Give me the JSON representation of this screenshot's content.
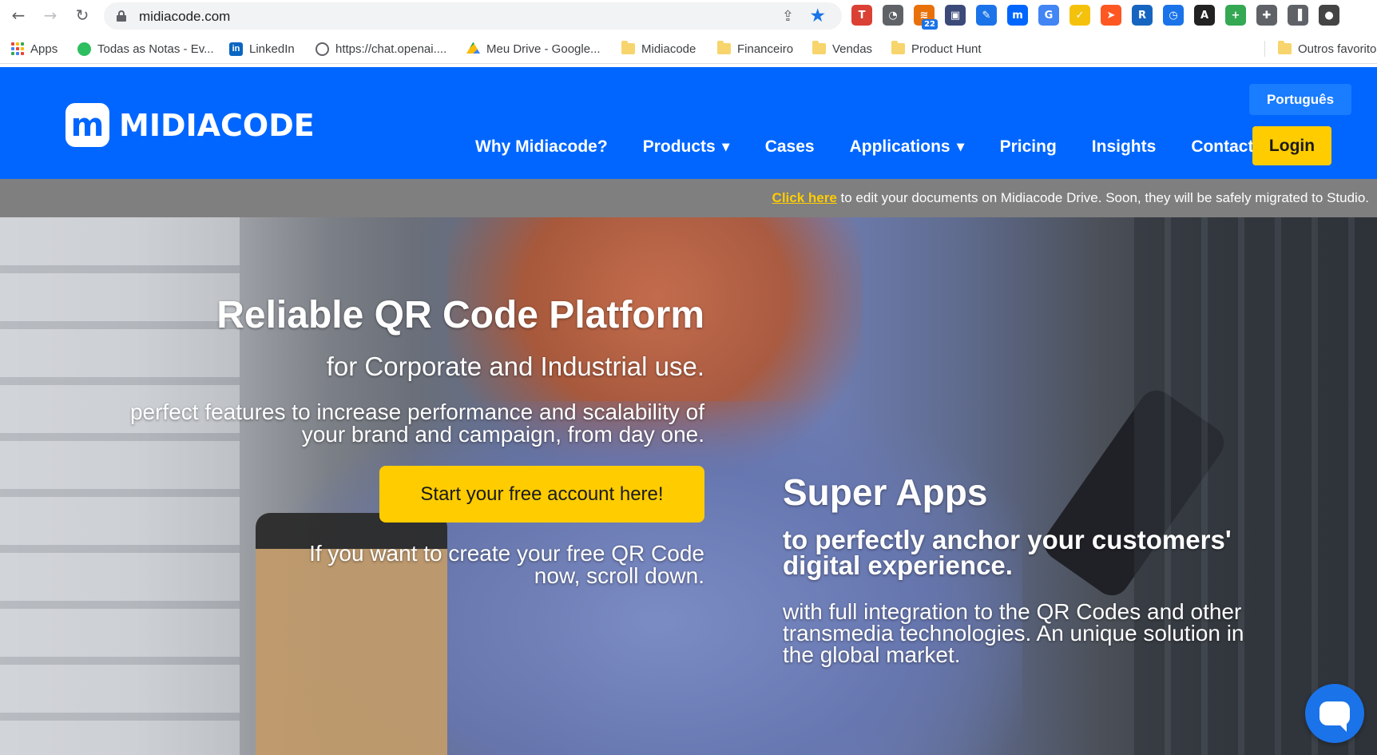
{
  "browser": {
    "url": "midiacode.com",
    "extensions": [
      {
        "name": "todoist-extension-icon",
        "glyph": "T",
        "color": "#db4035"
      },
      {
        "name": "speedometer-extension-icon",
        "glyph": "◔",
        "color": "#5f6368"
      },
      {
        "name": "feed-extension-icon",
        "glyph": "≋",
        "color": "#e8710a",
        "badge": "22"
      },
      {
        "name": "picture-extension-icon",
        "glyph": "▣",
        "color": "#3c4a7a"
      },
      {
        "name": "pen-extension-icon",
        "glyph": "✎",
        "color": "#1a73e8"
      },
      {
        "name": "midiacode-extension-icon",
        "glyph": "m",
        "color": "#0066ff"
      },
      {
        "name": "translate-extension-icon",
        "glyph": "G",
        "color": "#4285f4"
      },
      {
        "name": "checkmark-extension-icon",
        "glyph": "✓",
        "color": "#f4c20d"
      },
      {
        "name": "paper-plane-extension-icon",
        "glyph": "➤",
        "color": "#ff5722"
      },
      {
        "name": "r-extension-icon",
        "glyph": "R",
        "color": "#1565c0"
      },
      {
        "name": "clock-extension-icon",
        "glyph": "◷",
        "color": "#1a73e8"
      },
      {
        "name": "a-extension-icon",
        "glyph": "A",
        "color": "#222222"
      },
      {
        "name": "plus-extension-icon",
        "glyph": "+",
        "color": "#34a853"
      },
      {
        "name": "puzzle-extension-icon",
        "glyph": "✚",
        "color": "#5f6368"
      },
      {
        "name": "side-panel-icon",
        "glyph": "▐",
        "color": "#5f6368"
      },
      {
        "name": "profile-avatar-icon",
        "glyph": "●",
        "color": "#444444"
      }
    ],
    "bookmarks": {
      "apps": "Apps",
      "evernote": "Todas as Notas - Ev...",
      "linkedin": "LinkedIn",
      "chatgpt": "https://chat.openai....",
      "drive": "Meu Drive - Google...",
      "midiacode": "Midiacode",
      "financeiro": "Financeiro",
      "vendas": "Vendas",
      "producthunt": "Product Hunt",
      "others": "Outros favoritos"
    }
  },
  "header": {
    "logo_mark": "m",
    "logo_text": "MIDIACODE",
    "language": "Português",
    "nav": {
      "why": "Why Midiacode?",
      "products": "Products",
      "cases": "Cases",
      "applications": "Applications",
      "pricing": "Pricing",
      "insights": "Insights",
      "contact": "Contact"
    },
    "login": "Login",
    "brand_color": "#0066ff",
    "accent_color": "#ffcc00"
  },
  "notice": {
    "link": "Click here",
    "text": " to edit your documents on Midiacode Drive. Soon, they will be safely migrated to Studio."
  },
  "hero": {
    "title": "Reliable QR Code Platform",
    "subtitle": "for Corporate and Industrial use.",
    "body": "perfect features to increase performance and scalability of your brand and campaign, from day one.",
    "cta": "Start your free account here!",
    "free_note": "If you want to create your free QR Code now, scroll down.",
    "super_apps_title": "Super Apps",
    "super_apps_subtitle": "to perfectly anchor your customers' digital experience.",
    "super_apps_body": "with full integration to the QR Codes and other transmedia technologies. An unique solution in the global market."
  }
}
